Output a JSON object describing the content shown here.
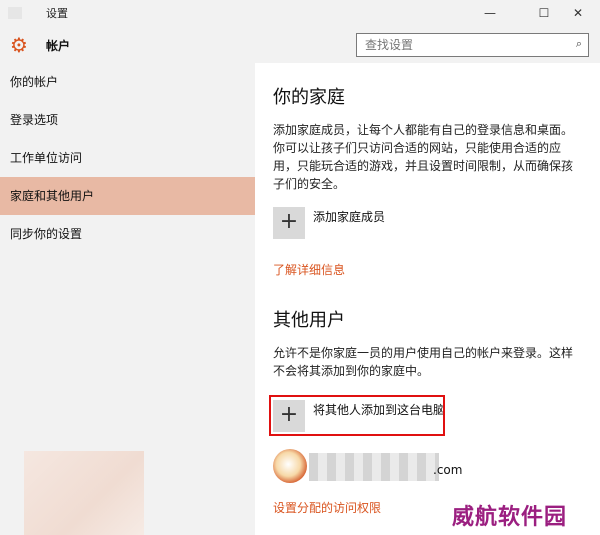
{
  "window": {
    "title": "设置",
    "buttons": {
      "minimize": "—",
      "maximize": "☐",
      "close": "✕"
    }
  },
  "header": {
    "section_title": "帐户",
    "search_placeholder": "查找设置"
  },
  "sidebar": {
    "items": [
      {
        "label": "你的帐户",
        "active": false
      },
      {
        "label": "登录选项",
        "active": false
      },
      {
        "label": "工作单位访问",
        "active": false
      },
      {
        "label": "家庭和其他用户",
        "active": true
      },
      {
        "label": "同步你的设置",
        "active": false
      }
    ]
  },
  "family": {
    "heading": "你的家庭",
    "description": "添加家庭成员，让每个人都能有自己的登录信息和桌面。你可以让孩子们只访问合适的网站，只能使用合适的应用，只能玩合适的游戏，并且设置时间限制，从而确保孩子们的安全。",
    "add_label": "添加家庭成员",
    "learn_more": "了解详细信息"
  },
  "others": {
    "heading": "其他用户",
    "description": "允许不是你家庭一员的用户使用自己的帐户来登录。这样不会将其添加到你的家庭中。",
    "add_label": "将其他人添加到这台电脑",
    "email_tail": ".com",
    "assigned_access": "设置分配的访问权限"
  },
  "watermark": "威航软件园",
  "colors": {
    "accent": "#d9541f",
    "active_item": "#e8b9a4",
    "highlight_box": "#e01010",
    "sidebar_bg": "#f2f2f2"
  },
  "icons": [
    "back-icon",
    "gear-icon",
    "search-icon",
    "plus-icon",
    "user-avatar-icon"
  ]
}
